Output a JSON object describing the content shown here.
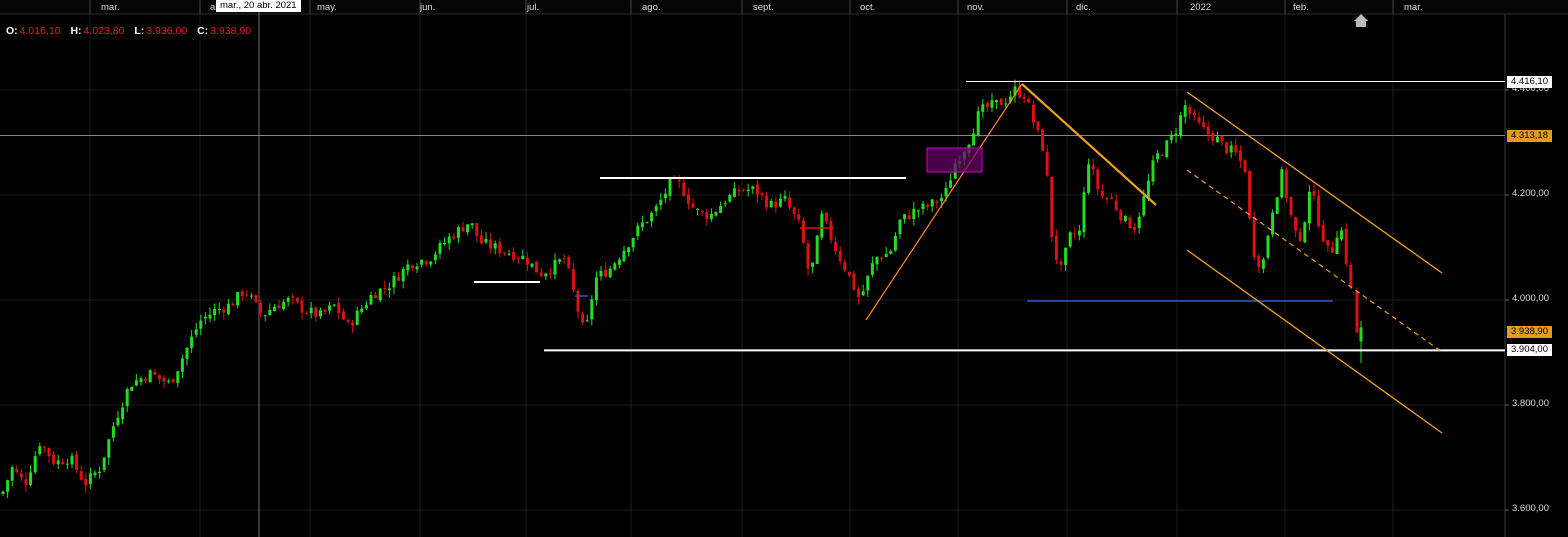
{
  "ohlc": {
    "o_label": "O:",
    "o": "4.016,10",
    "h_label": "H:",
    "h": "4.023,80",
    "l_label": "L:",
    "l": "3.936,00",
    "c_label": "C:",
    "c": "3.938,90"
  },
  "crosshair_date": "mar., 20 abr. 2021",
  "chart_data": {
    "type": "candlestick",
    "x_axis_labels": [
      "mar.",
      "ab",
      "may.",
      "jun.",
      "jul.",
      "ago.",
      "sept.",
      "oct.",
      "nov.",
      "dic.",
      "2022",
      "feb.",
      "mar."
    ],
    "y_axis_labels": [
      "4.400,00",
      "4.200,00",
      "4.000,00",
      "3.800,00",
      "3.600,00"
    ],
    "y_tick_values": [
      4400,
      4200,
      4000,
      3800,
      3600
    ],
    "ylim": [
      3560,
      4565
    ],
    "price_tags": [
      {
        "label": "4.416,10",
        "style": "white"
      },
      {
        "label": "4.313,18",
        "style": "orange"
      },
      {
        "label": "3.938,90",
        "style": "orange"
      },
      {
        "label": "3.904,00",
        "style": "white"
      }
    ],
    "horizontal_levels": [
      4416.1,
      4313.18,
      3904.0
    ],
    "last_candle": {
      "open": 4016.1,
      "high": 4023.8,
      "low": 3936.0,
      "close": 3938.9
    },
    "price_path": [
      [
        0,
        3620
      ],
      [
        12,
        3680
      ],
      [
        25,
        3650
      ],
      [
        40,
        3730
      ],
      [
        55,
        3690
      ],
      [
        70,
        3700
      ],
      [
        85,
        3650
      ],
      [
        100,
        3680
      ],
      [
        115,
        3770
      ],
      [
        130,
        3840
      ],
      [
        150,
        3860
      ],
      [
        170,
        3840
      ],
      [
        185,
        3900
      ],
      [
        200,
        3960
      ],
      [
        215,
        3980
      ],
      [
        230,
        3990
      ],
      [
        245,
        4020
      ],
      [
        262,
        3970
      ],
      [
        275,
        3990
      ],
      [
        290,
        4000
      ],
      [
        305,
        3980
      ],
      [
        320,
        3970
      ],
      [
        335,
        3990
      ],
      [
        348,
        3950
      ],
      [
        360,
        3980
      ],
      [
        372,
        4010
      ],
      [
        390,
        4030
      ],
      [
        410,
        4070
      ],
      [
        430,
        4080
      ],
      [
        450,
        4120
      ],
      [
        470,
        4150
      ],
      [
        480,
        4110
      ],
      [
        495,
        4100
      ],
      [
        510,
        4090
      ],
      [
        525,
        4080
      ],
      [
        540,
        4050
      ],
      [
        550,
        4060
      ],
      [
        565,
        4080
      ],
      [
        578,
        3980
      ],
      [
        585,
        3930
      ],
      [
        595,
        4040
      ],
      [
        610,
        4060
      ],
      [
        625,
        4100
      ],
      [
        640,
        4140
      ],
      [
        655,
        4170
      ],
      [
        670,
        4220
      ],
      [
        680,
        4220
      ],
      [
        695,
        4170
      ],
      [
        710,
        4160
      ],
      [
        725,
        4190
      ],
      [
        740,
        4210
      ],
      [
        755,
        4210
      ],
      [
        770,
        4180
      ],
      [
        785,
        4190
      ],
      [
        800,
        4140
      ],
      [
        810,
        4040
      ],
      [
        822,
        4160
      ],
      [
        835,
        4100
      ],
      [
        848,
        4050
      ],
      [
        860,
        4000
      ],
      [
        875,
        4080
      ],
      [
        890,
        4090
      ],
      [
        900,
        4150
      ],
      [
        915,
        4170
      ],
      [
        930,
        4180
      ],
      [
        945,
        4200
      ],
      [
        955,
        4260
      ],
      [
        968,
        4300
      ],
      [
        980,
        4360
      ],
      [
        992,
        4370
      ],
      [
        1005,
        4380
      ],
      [
        1015,
        4400
      ],
      [
        1025,
        4390
      ],
      [
        1035,
        4330
      ],
      [
        1045,
        4280
      ],
      [
        1052,
        4120
      ],
      [
        1060,
        4050
      ],
      [
        1070,
        4120
      ],
      [
        1080,
        4130
      ],
      [
        1088,
        4270
      ],
      [
        1100,
        4200
      ],
      [
        1112,
        4190
      ],
      [
        1125,
        4150
      ],
      [
        1135,
        4140
      ],
      [
        1145,
        4200
      ],
      [
        1155,
        4270
      ],
      [
        1165,
        4290
      ],
      [
        1175,
        4320
      ],
      [
        1185,
        4370
      ],
      [
        1195,
        4340
      ],
      [
        1205,
        4320
      ],
      [
        1215,
        4310
      ],
      [
        1225,
        4290
      ],
      [
        1235,
        4280
      ],
      [
        1245,
        4250
      ],
      [
        1252,
        4100
      ],
      [
        1262,
        4060
      ],
      [
        1272,
        4170
      ],
      [
        1282,
        4240
      ],
      [
        1292,
        4150
      ],
      [
        1300,
        4100
      ],
      [
        1310,
        4220
      ],
      [
        1320,
        4140
      ],
      [
        1330,
        4080
      ],
      [
        1340,
        4150
      ],
      [
        1350,
        4030
      ],
      [
        1357,
        3938
      ]
    ]
  },
  "colors": {
    "background": "#000000",
    "up": "#22dd22",
    "down": "#dd1111",
    "orange": "#f0a020",
    "blue": "#2a55cc",
    "magenta": "#b000b0"
  },
  "icons": {
    "top_right": "home-icon"
  }
}
